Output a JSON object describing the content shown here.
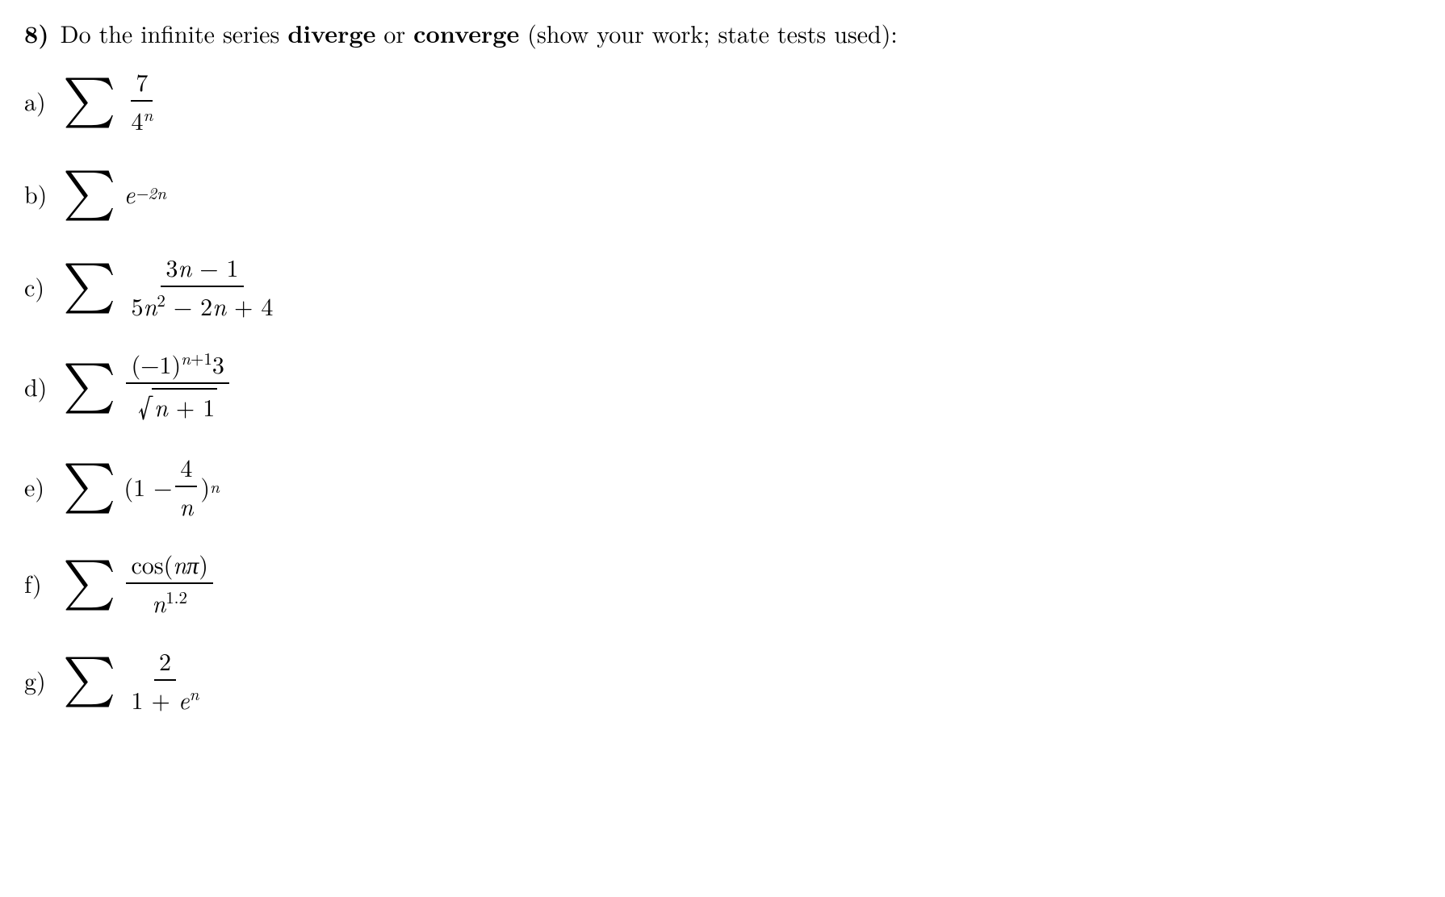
{
  "problem": {
    "number": "8)",
    "prompt_pre": "Do the infinite series ",
    "prompt_bold1": "diverge",
    "prompt_mid": " or ",
    "prompt_bold2": "converge",
    "prompt_post": " (show your work; state tests used):"
  },
  "items": {
    "a": {
      "label": "a)",
      "num": "7",
      "den_base": "4",
      "den_exp": "n"
    },
    "b": {
      "label": "b)",
      "base": "e",
      "exp": "−2n"
    },
    "c": {
      "label": "c)",
      "num": "3n − 1",
      "den_pre": "5",
      "den_n": "n",
      "den_exp": "2",
      "den_post": " − 2n + 4"
    },
    "d": {
      "label": "d)",
      "num_neg1": "(−1)",
      "num_exp": "n+1",
      "num_three": "3",
      "den_sqrt": "n + 1"
    },
    "e": {
      "label": "e)",
      "open": "(1 − ",
      "frac_num": "4",
      "frac_den": "n",
      "close": ")",
      "outer_exp": "n"
    },
    "f": {
      "label": "f)",
      "num_cos": "cos(",
      "num_n": "n",
      "num_pi": "π",
      "num_close": ")",
      "den_n": "n",
      "den_exp": "1.2"
    },
    "g": {
      "label": "g)",
      "num": "2",
      "den_pre": "1 + ",
      "den_e": "e",
      "den_exp": "n"
    }
  }
}
